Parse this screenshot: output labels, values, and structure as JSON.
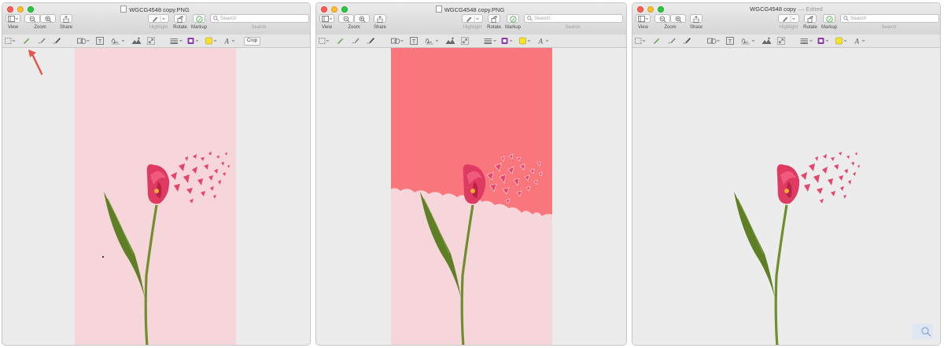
{
  "colors": {
    "background_pink": "#f6d6da",
    "removed_highlight": "#f9777c",
    "tulip_red": "#e23a5f",
    "stem_green": "#6b8b2a",
    "annotation_arrow": "#e5534b",
    "markup_highlight_green": "#48b04a"
  },
  "windows": [
    {
      "title": "WGCG4548 copy.PNG",
      "title_edited": "",
      "toolbar": {
        "view_label": "View",
        "zoom_label": "Zoom",
        "share_label": "Share",
        "highlight_label": "Highlight",
        "rotate_label": "Rotate",
        "markup_label": "Markup",
        "search_label": "Search",
        "search_placeholder": "Search"
      },
      "markup": {
        "crop_label": "Crop"
      }
    },
    {
      "title": "WGCG4548 copy.PNG",
      "title_edited": "",
      "toolbar": {
        "view_label": "View",
        "zoom_label": "Zoom",
        "share_label": "Share",
        "highlight_label": "Highlight",
        "rotate_label": "Rotate",
        "markup_label": "Markup",
        "search_label": "Search",
        "search_placeholder": "Search"
      },
      "markup": {
        "crop_label": ""
      }
    },
    {
      "title": "WGCG4548 copy",
      "title_edited": "— Edited",
      "toolbar": {
        "view_label": "View",
        "zoom_label": "Zoom",
        "share_label": "Share",
        "highlight_label": "Highlight",
        "rotate_label": "Rotate",
        "markup_label": "Markup",
        "search_label": "Search",
        "search_placeholder": "Search"
      },
      "markup": {
        "crop_label": ""
      }
    }
  ],
  "icons": {
    "sidebar": "sidebar-icon",
    "zoom_out": "zoom-out-icon",
    "zoom_in": "zoom-in-icon",
    "share": "share-icon",
    "highlight": "pen-icon",
    "rotate": "rotate-icon",
    "markup": "markup-icon",
    "search": "search-icon",
    "selection": "rectangle-select-icon",
    "instant_alpha": "instant-alpha-icon",
    "sketch": "sketch-icon",
    "draw": "draw-icon",
    "shapes": "shapes-icon",
    "text": "text-box-icon",
    "sign": "signature-icon",
    "adjust_color": "adjust-color-icon",
    "adjust_size": "adjust-size-icon",
    "shape_style": "line-style-icon",
    "border_color": "border-color-icon",
    "fill_color": "fill-color-icon",
    "text_style": "text-style-icon"
  }
}
